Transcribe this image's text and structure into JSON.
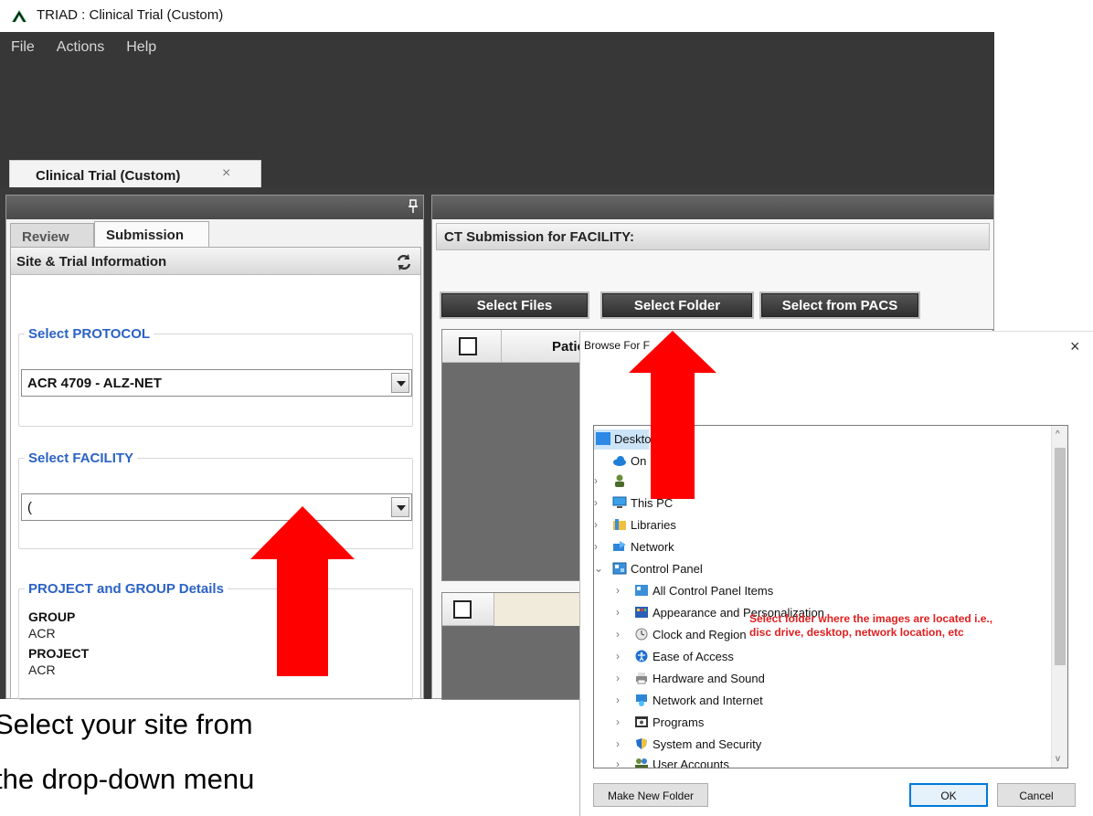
{
  "window": {
    "title": "TRIAD : Clinical Trial (Custom)"
  },
  "menu": {
    "items": [
      "File",
      "Actions",
      "Help"
    ]
  },
  "doc_tab": {
    "label": "Clinical Trial (Custom)",
    "close": "×"
  },
  "left": {
    "tabs": {
      "review": "Review",
      "submission": "Submission"
    },
    "section_title": "Site & Trial Information",
    "protocol": {
      "legend": "Select PROTOCOL",
      "value": "ACR 4709 - ALZ-NET"
    },
    "facility": {
      "legend": "Select FACILITY",
      "value": "("
    },
    "project": {
      "legend": "PROJECT and GROUP Details",
      "group_label": "GROUP",
      "group_value": "ACR",
      "project_label": "PROJECT",
      "project_value": "ACR"
    }
  },
  "right": {
    "title": "CT Submission for FACILITY:",
    "buttons": {
      "files": "Select Files",
      "folder": "Select Folder",
      "pacs": "Select from PACS"
    },
    "grid_col_patient": "Patie"
  },
  "dialog": {
    "title": "Browse For F",
    "close": "×",
    "tree": {
      "desktop": "Deskto",
      "onedrive": "On",
      "thispc": "This PC",
      "libraries": "Libraries",
      "network": "Network",
      "control_panel": "Control Panel",
      "children": [
        "All Control Panel Items",
        "Appearance and Personalization",
        "Clock and Region",
        "Ease of Access",
        "Hardware and Sound",
        "Network and Internet",
        "Programs",
        "System and Security",
        "User Accounts"
      ]
    },
    "note_line1": "Select folder where the images are located i.e.,",
    "note_line2": "disc drive, desktop, network location, etc",
    "buttons": {
      "new_folder": "Make New Folder",
      "ok": "OK",
      "cancel": "Cancel"
    }
  },
  "caption": {
    "line1": "Select your site from",
    "line2": "the drop-down menu"
  },
  "colors": {
    "accent_blue": "#2b62c6",
    "arrow_red": "#ff0000",
    "app_dark": "#373737"
  }
}
